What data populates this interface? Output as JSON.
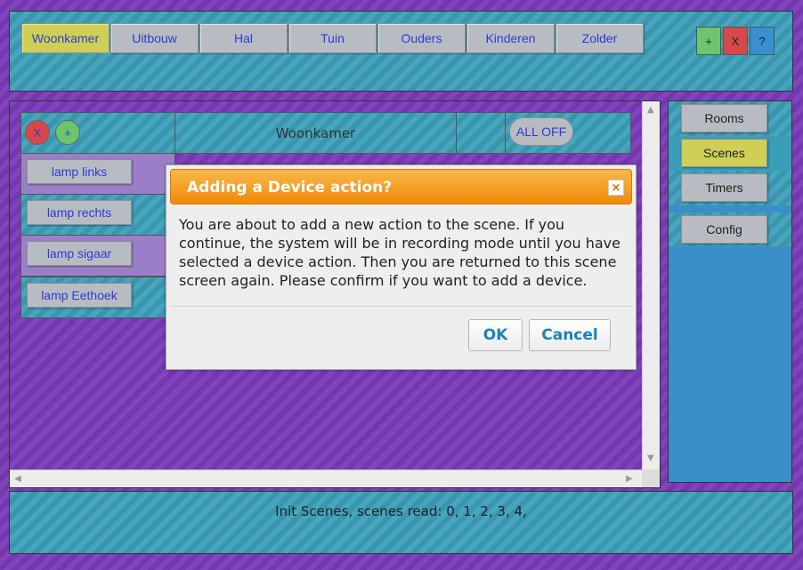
{
  "top_nav": {
    "rooms": [
      "Woonkamer",
      "Uitbouw",
      "Hal",
      "Tuin",
      "Ouders",
      "Kinderen",
      "Zolder"
    ],
    "active_room": "Woonkamer",
    "add_label": "+",
    "remove_label": "X",
    "help_label": "?"
  },
  "scene": {
    "delete_label": "X",
    "add_label": "+",
    "title": "Woonkamer",
    "all_off_label": "ALL OFF",
    "devices": [
      "lamp links",
      "lamp rechts",
      "lamp sigaar",
      "lamp Eethoek"
    ]
  },
  "side_nav": {
    "rooms_label": "Rooms",
    "scenes_label": "Scenes",
    "timers_label": "Timers",
    "config_label": "Config",
    "active": "Scenes"
  },
  "status": {
    "text": "Init Scenes, scenes read: 0, 1, 2, 3, 4,"
  },
  "dialog": {
    "title": "Adding a Device action?",
    "close_label": "×",
    "message": "You are about to add a new action to the scene. If you continue, the system will be in recording mode until you have selected a device action. Then you are returned to this scene screen again. Please confirm if you want to add a device.",
    "ok_label": "OK",
    "cancel_label": "Cancel"
  },
  "colors": {
    "background": "#7a3ab8",
    "panel": "#3b9eb8",
    "active_tab": "#cfcf55",
    "button": "#b8bcc2",
    "dialog_title": "#f39c1e",
    "dialog_button_text": "#1a82c0"
  }
}
